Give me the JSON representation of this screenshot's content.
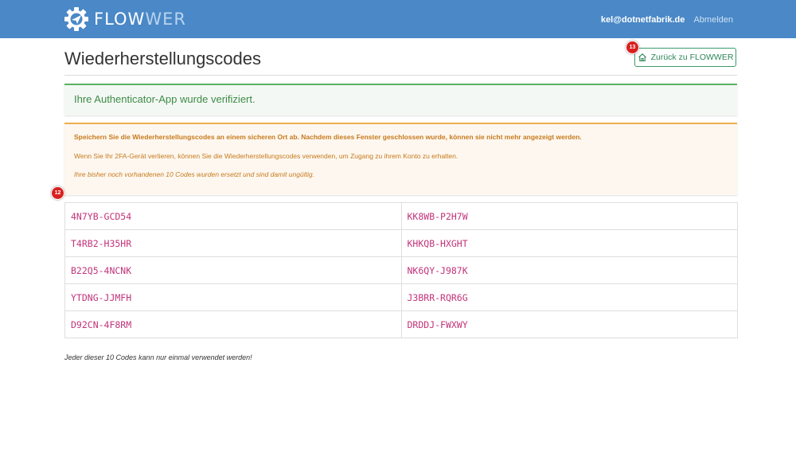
{
  "header": {
    "brand_strong": "FLOW",
    "brand_light": "WER",
    "user_email": "kel@dotnetfabrik.de",
    "logout_label": "Abmelden",
    "logo_icon": "gear-airplane-icon"
  },
  "page": {
    "title": "Wiederherstellungscodes",
    "back_button_label": "Zurück zu FLOWWER",
    "back_button_icon": "home-icon"
  },
  "alerts": {
    "success_text": "Ihre Authenticator-App wurde verifiziert.",
    "warning_bold": "Speichern Sie die Wiederherstellungscodes an einem sicheren Ort ab. Nachdem dieses Fenster geschlossen wurde, können sie nicht mehr angezeigt werden.",
    "warning_text": "Wenn Sie Ihr 2FA-Gerät verlieren, können Sie die Wiederherstellungscodes verwenden, um Zugang zu ihrem Konto zu erhalten.",
    "warning_italic": "Ihre bisher noch vorhandenen 10 Codes wurden ersetzt und sind damit ungültig."
  },
  "badges": {
    "codes_marker": "12",
    "back_marker": "13"
  },
  "codes": {
    "rows": [
      [
        "4N7YB-GCD54",
        "KK8WB-P2H7W"
      ],
      [
        "T4RB2-H35HR",
        "KHKQB-HXGHT"
      ],
      [
        "B22Q5-4NCNK",
        "NK6QY-J987K"
      ],
      [
        "YTDNG-JJMFH",
        "J3BRR-RQR6G"
      ],
      [
        "D92CN-4F8RM",
        "DRDDJ-FWXWY"
      ]
    ]
  },
  "footnote": "Jeder dieser 10 Codes kann nur einmal verwendet werden!",
  "colors": {
    "header_bg": "#4a88c7",
    "success": "#59b262",
    "warning": "#f0ad4e",
    "code_text": "#c2347a",
    "badge": "#d9201f"
  }
}
